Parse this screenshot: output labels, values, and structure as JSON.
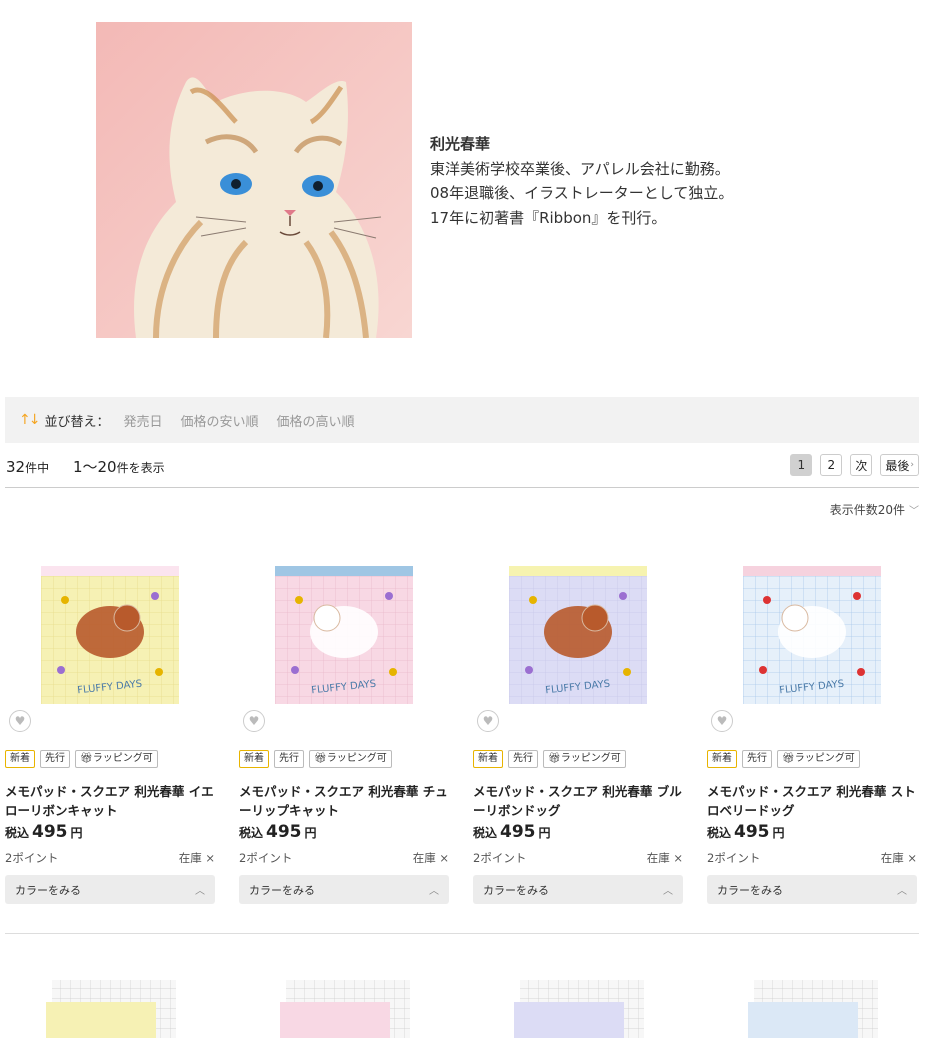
{
  "artist": {
    "name": "利光春華",
    "bio": [
      "東洋美術学校卒業後、アパレル会社に勤務。",
      "08年退職後、イラストレーターとして独立。",
      "17年に初著書『Ribbon』を刊行。"
    ]
  },
  "sort": {
    "label": "並び替え：",
    "options": [
      "発売日",
      "価格の安い順",
      "価格の高い順"
    ]
  },
  "results": {
    "total": "32",
    "total_unit": "件中",
    "range": "1〜20",
    "range_unit": "件を表示"
  },
  "pager": {
    "pages": [
      "1",
      "2"
    ],
    "next": "次",
    "last": "最後",
    "current": "1"
  },
  "per_page": "表示件数20件",
  "products": [
    {
      "title": "メモパッド・スクエア 利光春華 イエローリボンキャット",
      "price": "495",
      "points": "2ポイント",
      "stock": "在庫 ×",
      "badges": [
        "新着",
        "先行",
        "ラッピング可"
      ],
      "color_button": "カラーをみる",
      "tax_label": "税込",
      "yen": "円",
      "art_text": "FLUFFY DAYS",
      "colors": {
        "bg": "#f6f1b4",
        "top": "#fbe4ef",
        "grid": "#e8dc8c"
      }
    },
    {
      "title": "メモパッド・スクエア 利光春華 チューリップキャット",
      "price": "495",
      "points": "2ポイント",
      "stock": "在庫 ×",
      "badges": [
        "新着",
        "先行",
        "ラッピング可"
      ],
      "color_button": "カラーをみる",
      "tax_label": "税込",
      "yen": "円",
      "art_text": "FLUFFY DAYS",
      "colors": {
        "bg": "#f8d8e4",
        "top": "#9fc6e4",
        "grid": "#eab9cb"
      }
    },
    {
      "title": "メモパッド・スクエア 利光春華 ブルーリボンドッグ",
      "price": "495",
      "points": "2ポイント",
      "stock": "在庫 ×",
      "badges": [
        "新着",
        "先行",
        "ラッピング可"
      ],
      "color_button": "カラーをみる",
      "tax_label": "税込",
      "yen": "円",
      "art_text": "FLUFFY DAYS",
      "colors": {
        "bg": "#dcdcf5",
        "top": "#f6f3b0",
        "grid": "#c8c8ea"
      }
    },
    {
      "title": "メモパッド・スクエア 利光春華 ストロベリードッグ",
      "price": "495",
      "points": "2ポイント",
      "stock": "在庫 ×",
      "badges": [
        "新着",
        "先行",
        "ラッピング可"
      ],
      "color_button": "カラーをみる",
      "tax_label": "税込",
      "yen": "円",
      "art_text": "FLUFFY DAYS",
      "colors": {
        "bg": "#e6f0fa",
        "top": "#f6d2de",
        "grid": "#a9c9ea"
      }
    }
  ],
  "row2_colors": [
    "#f6f1b4",
    "#f8d8e4",
    "#dcdcf5",
    "#dbe8f6"
  ],
  "theme": {
    "accent": "#f5a623",
    "new_badge_border": "#e8b400",
    "sortbar_bg": "#f2f2f2"
  }
}
